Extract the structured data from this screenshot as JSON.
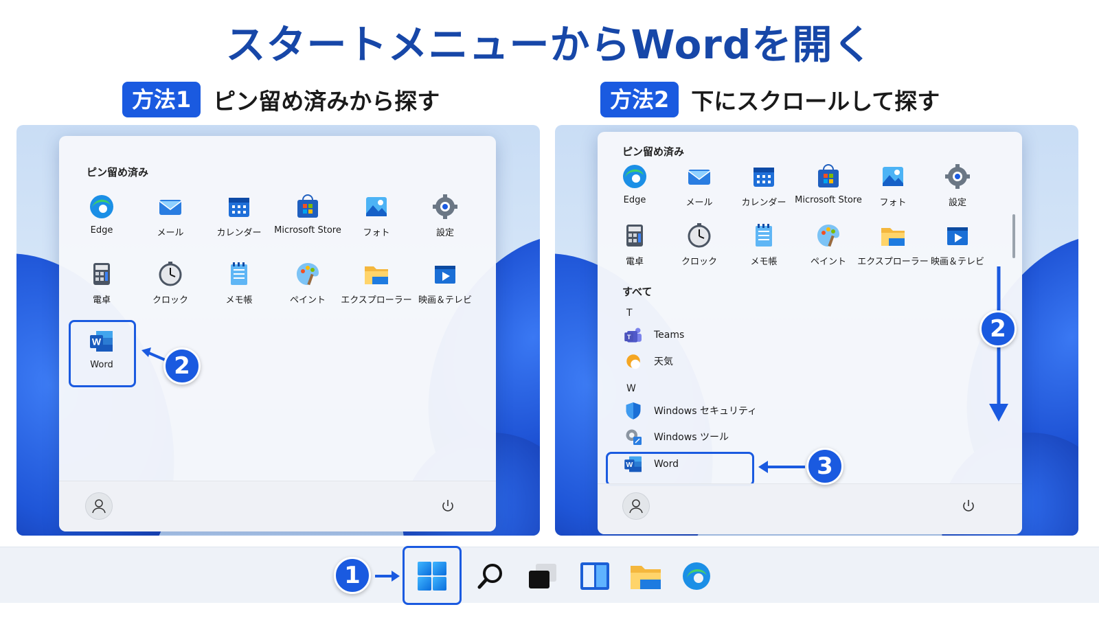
{
  "title": "スタートメニューからWordを開く",
  "method1": {
    "badge": "方法1",
    "text": "ピン留め済みから探す"
  },
  "method2": {
    "badge": "方法2",
    "text": "下にスクロールして探す"
  },
  "left_menu": {
    "pinned_label": "ピン留め済み",
    "apps": [
      {
        "label": "Edge",
        "icon": "edge-icon"
      },
      {
        "label": "メール",
        "icon": "mail-icon"
      },
      {
        "label": "カレンダー",
        "icon": "calendar-icon"
      },
      {
        "label": "Microsoft Store",
        "icon": "store-icon"
      },
      {
        "label": "フォト",
        "icon": "photos-icon"
      },
      {
        "label": "設定",
        "icon": "settings-icon"
      },
      {
        "label": "電卓",
        "icon": "calculator-icon"
      },
      {
        "label": "クロック",
        "icon": "clock-icon"
      },
      {
        "label": "メモ帳",
        "icon": "notepad-icon"
      },
      {
        "label": "ペイント",
        "icon": "paint-icon"
      },
      {
        "label": "エクスプローラー",
        "icon": "folder-icon"
      },
      {
        "label": "映画＆テレビ",
        "icon": "movies-icon"
      },
      {
        "label": "Word",
        "icon": "word-icon"
      }
    ],
    "step_badge": "2"
  },
  "right_menu": {
    "pinned_label": "ピン留め済み",
    "apps": [
      {
        "label": "Edge",
        "icon": "edge-icon"
      },
      {
        "label": "メール",
        "icon": "mail-icon"
      },
      {
        "label": "カレンダー",
        "icon": "calendar-icon"
      },
      {
        "label": "Microsoft Store",
        "icon": "store-icon"
      },
      {
        "label": "フォト",
        "icon": "photos-icon"
      },
      {
        "label": "設定",
        "icon": "settings-icon"
      },
      {
        "label": "電卓",
        "icon": "calculator-icon"
      },
      {
        "label": "クロック",
        "icon": "clock-icon"
      },
      {
        "label": "メモ帳",
        "icon": "notepad-icon"
      },
      {
        "label": "ペイント",
        "icon": "paint-icon"
      },
      {
        "label": "エクスプローラー",
        "icon": "folder-icon"
      },
      {
        "label": "映画＆テレビ",
        "icon": "movies-icon"
      }
    ],
    "all_label": "すべて",
    "letter_t": "T",
    "letter_w": "W",
    "list": [
      {
        "label": "Teams",
        "icon": "teams-icon"
      },
      {
        "label": "天気",
        "icon": "weather-icon"
      },
      {
        "label": "Windows セキュリティ",
        "icon": "shield-icon"
      },
      {
        "label": "Windows ツール",
        "icon": "tools-icon"
      },
      {
        "label": "Word",
        "icon": "word-icon"
      }
    ],
    "step_badge_scroll": "2",
    "step_badge_word": "3"
  },
  "taskbar": {
    "step_badge": "1",
    "icons": [
      "start-icon",
      "search-icon",
      "task-view-icon",
      "widgets-icon",
      "file-explorer-icon",
      "edge-icon"
    ]
  },
  "colors": {
    "accent": "#1a5ae0",
    "title": "#1747a8"
  }
}
